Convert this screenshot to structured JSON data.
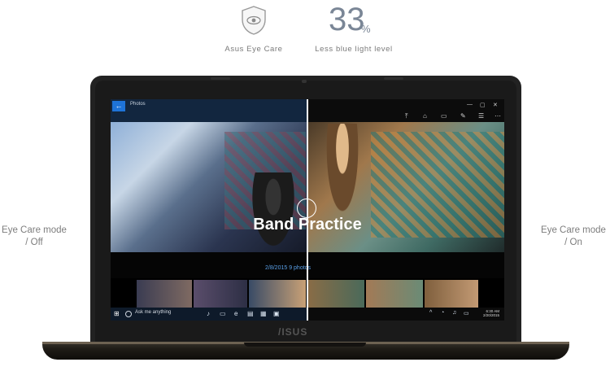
{
  "feature": {
    "name": "Asus Eye Care",
    "stat_value": "33",
    "stat_unit": "%",
    "stat_label": "Less blue light level"
  },
  "modes": {
    "left_line1": "Eye Care mode",
    "left_line2": "/ Off",
    "right_line1": "Eye Care mode",
    "right_line2": "/ On"
  },
  "laptop": {
    "logo": "/ISUS"
  },
  "photos_app": {
    "back_label": "←",
    "title": "Photos",
    "album_title": "Band Practice",
    "album_meta": "2/8/2015  9 photos",
    "toolbar_icons": [
      "share-icon",
      "enhance-icon",
      "slideshow-icon",
      "edit-icon",
      "select-icon",
      "more-icon"
    ],
    "window_controls": [
      "—",
      "▢",
      "✕"
    ]
  },
  "taskbar": {
    "start_icon": "windows-icon",
    "search_placeholder": "Ask me anything",
    "time": "6:30 AM",
    "date": "2/20/2015"
  },
  "colors": {
    "accent": "#1e73d8",
    "stat": "#7a8696",
    "text": "#7a7a7a"
  }
}
